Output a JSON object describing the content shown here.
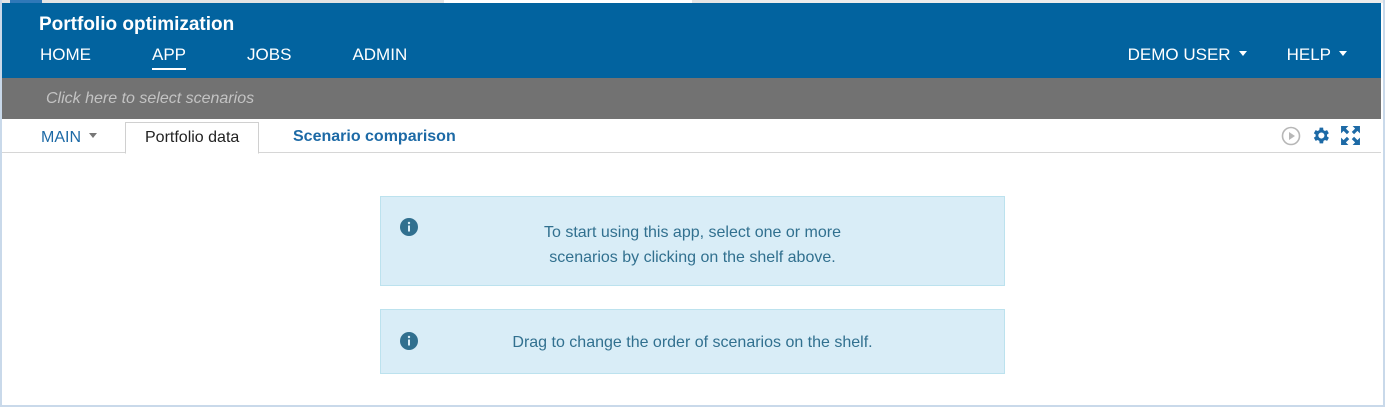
{
  "app": {
    "title": "Portfolio optimization"
  },
  "nav": {
    "items": [
      {
        "label": "HOME"
      },
      {
        "label": "APP"
      },
      {
        "label": "JOBS"
      },
      {
        "label": "ADMIN"
      }
    ],
    "user_menu": "DEMO USER",
    "help_menu": "HELP"
  },
  "shelf": {
    "placeholder": "Click here to select scenarios"
  },
  "tabs": {
    "main_dropdown": "MAIN",
    "items": [
      {
        "label": "Portfolio data"
      },
      {
        "label": "Scenario comparison"
      }
    ]
  },
  "messages": {
    "line1a": "To start using this app, select one or more",
    "line1b": "scenarios by clicking on the shelf above.",
    "line2": "Drag to change the order of scenarios on the shelf."
  },
  "colors": {
    "header": "#02639f",
    "shelf": "#727272",
    "alert_bg": "#d9edf7",
    "alert_text": "#31708f",
    "link": "#1d6aa6"
  }
}
